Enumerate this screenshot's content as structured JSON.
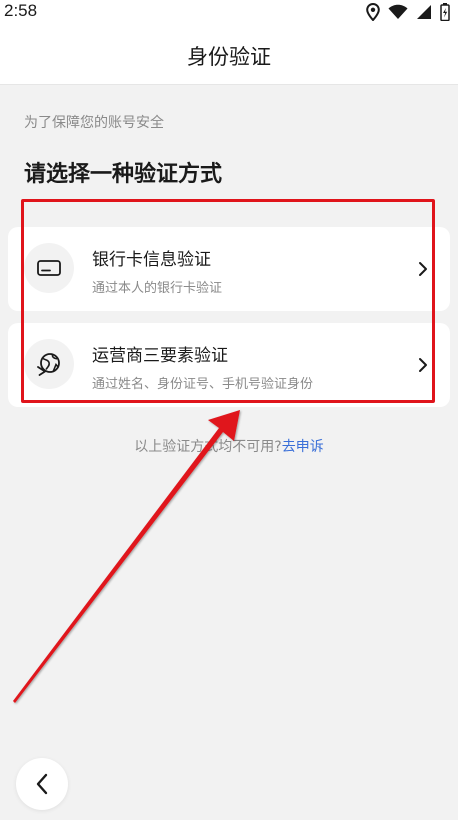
{
  "status_bar": {
    "time": "2:58"
  },
  "nav": {
    "title": "身份验证"
  },
  "subtitle": "为了保障您的账号安全",
  "heading": "请选择一种验证方式",
  "options": [
    {
      "title": "银行卡信息验证",
      "description": "通过本人的银行卡验证",
      "icon": "bank-card-icon"
    },
    {
      "title": "运营商三要素验证",
      "description": "通过姓名、身份证号、手机号验证身份",
      "icon": "carrier-globe-icon"
    }
  ],
  "fallback": {
    "text": "以上验证方式均不可用?",
    "link": "去申诉"
  },
  "colors": {
    "accent_link": "#3a6fd8",
    "highlight": "#e0141b"
  }
}
